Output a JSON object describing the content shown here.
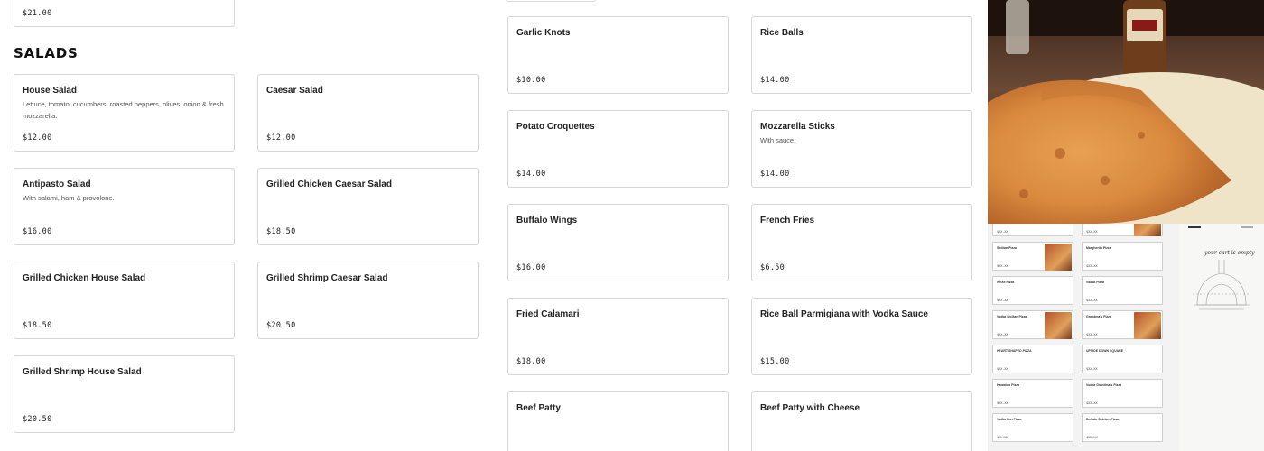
{
  "sections": {
    "salads_title": "SALADS"
  },
  "top_card_price": "$21.00",
  "salads": [
    {
      "name": "House Salad",
      "desc": "Lettuce, tomato, cucumbers, roasted peppers, olives, onion & fresh mozzarella.",
      "price": "$12.00"
    },
    {
      "name": "Caesar Salad",
      "desc": "",
      "price": "$12.00"
    },
    {
      "name": "Antipasto Salad",
      "desc": "With salami, ham & provolone.",
      "price": "$16.00"
    },
    {
      "name": "Grilled Chicken Caesar Salad",
      "desc": "",
      "price": "$18.50"
    },
    {
      "name": "Grilled Chicken House Salad",
      "desc": "",
      "price": "$18.50"
    },
    {
      "name": "Grilled Shrimp Caesar Salad",
      "desc": "",
      "price": "$20.50"
    },
    {
      "name": "Grilled Shrimp House Salad",
      "desc": "",
      "price": "$20.50"
    }
  ],
  "appetizers": [
    {
      "name": "Garlic Knots",
      "desc": "",
      "price": "$10.00"
    },
    {
      "name": "Rice Balls",
      "desc": "",
      "price": "$14.00"
    },
    {
      "name": "Potato Croquettes",
      "desc": "",
      "price": "$14.00"
    },
    {
      "name": "Mozzarella Sticks",
      "desc": "With sauce.",
      "price": "$14.00"
    },
    {
      "name": "Buffalo Wings",
      "desc": "",
      "price": "$16.00"
    },
    {
      "name": "French Fries",
      "desc": "",
      "price": "$6.50"
    },
    {
      "name": "Fried Calamari",
      "desc": "",
      "price": "$18.00"
    },
    {
      "name": "Rice Ball Parmigiana with Vodka Sauce",
      "desc": "",
      "price": "$15.00"
    },
    {
      "name": "Beef Patty",
      "desc": "",
      "price": ""
    },
    {
      "name": "Beef Patty with Cheese",
      "desc": "",
      "price": ""
    }
  ],
  "preview": {
    "left_col": [
      {
        "name": "",
        "price": "$XX.XX"
      },
      {
        "name": "Sicilian Pizza",
        "price": "$XX.XX",
        "img": true
      },
      {
        "name": "White Pizza",
        "price": "$XX.XX"
      },
      {
        "name": "Vodka Sicilian Pizza",
        "price": "$XX.XX",
        "img": true
      },
      {
        "name": "HEART SHAPED PIZZA",
        "price": "$XX.XX"
      },
      {
        "name": "Hawaiian Pizza",
        "price": "$XX.XX"
      },
      {
        "name": "Vodka Pan Pizza",
        "price": "$XX.XX"
      }
    ],
    "right_col": [
      {
        "name": "",
        "price": "$XX.XX",
        "img": true
      },
      {
        "name": "Margherita Pizza",
        "price": "$XX.XX"
      },
      {
        "name": "Vodka Pizza",
        "price": "$XX.XX"
      },
      {
        "name": "Grandma's Pizza",
        "price": "$XX.XX",
        "img": true
      },
      {
        "name": "UPSIDE DOWN SQUARE",
        "price": "$XX.XX"
      },
      {
        "name": "Vodka Grandma's Pizza",
        "price": "$XX.XX"
      },
      {
        "name": "Buffalo Chicken Pizza",
        "price": "$XX.XX"
      }
    ],
    "cart_text": "your cart is empty"
  },
  "colors": {
    "card_border": "#d6d6d6",
    "text": "#222222",
    "photo_bg": "#4a2f1f"
  }
}
